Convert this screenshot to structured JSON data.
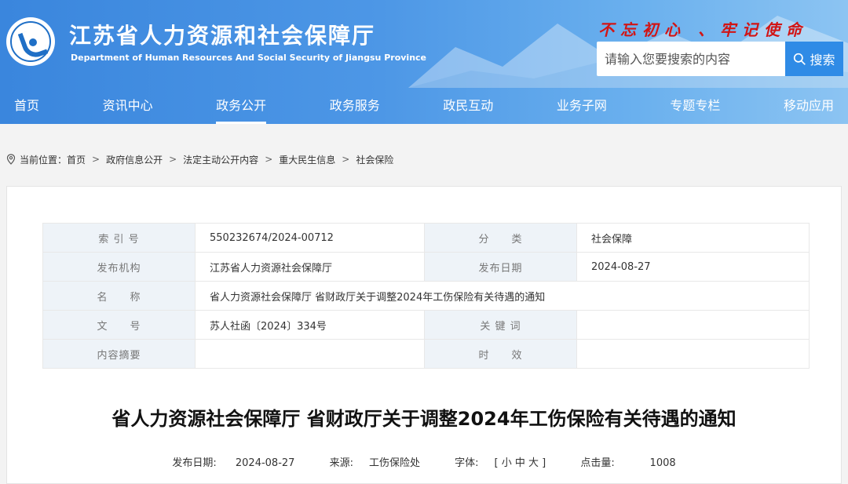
{
  "header": {
    "title": "江苏省人力资源和社会保障厅",
    "subtitle": "Department of Human Resources And Social Security of Jiangsu Province",
    "slogan": "不忘初心 、牢记使命",
    "search_placeholder": "请输入您要搜索的内容",
    "search_button": "搜索",
    "accent_color": "#3a86dd"
  },
  "nav": [
    "首页",
    "资讯中心",
    "政务公开",
    "政务服务",
    "政民互动",
    "业务子网",
    "专题专栏",
    "移动应用"
  ],
  "breadcrumb": {
    "label": "当前位置：",
    "items": [
      "首页",
      "政府信息公开",
      "法定主动公开内容",
      "重大民生信息",
      "社会保险"
    ]
  },
  "meta": [
    [
      "索 引 号",
      "550232674/2024-00712",
      "分　　类",
      "社会保障"
    ],
    [
      "发布机构",
      "江苏省人力资源社会保障厅",
      "发布日期",
      "2024-08-27"
    ],
    [
      "名　　称",
      "省人力资源社会保障厅 省财政厅关于调整2024年工伤保险有关待遇的通知"
    ],
    [
      "文　　号",
      "苏人社函〔2024〕334号",
      "关 键 词",
      ""
    ],
    [
      "内容摘要",
      "",
      "时　　效",
      ""
    ]
  ],
  "article": {
    "title": "省人力资源社会保障厅 省财政厅关于调整2024年工伤保险有关待遇的通知",
    "date_label": "发布日期:",
    "date": "2024-08-27",
    "source_label": "来源:",
    "source": "工伤保险处",
    "font_label": "字体:",
    "font_options": "[ 小 中 大 ]",
    "views_label": "点击量:",
    "views": "1008"
  }
}
